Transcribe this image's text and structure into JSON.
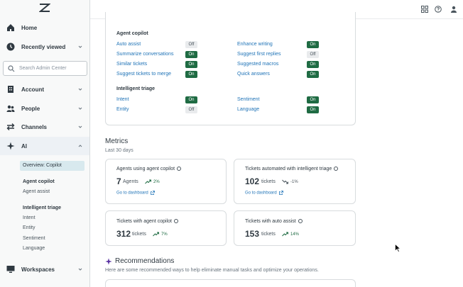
{
  "sidebar": {
    "nav": [
      {
        "label": "Home"
      },
      {
        "label": "Recently viewed"
      },
      {
        "label": "Account"
      },
      {
        "label": "People"
      },
      {
        "label": "Channels"
      },
      {
        "label": "AI"
      },
      {
        "label": "Workspaces"
      }
    ],
    "search_placeholder": "Search Admin Center",
    "ai_submenu": {
      "overview": "Overview: Copilot",
      "agent_copilot_header": "Agent copilot",
      "agent_assist": "Agent assist",
      "intelligent_triage_header": "Intelligent triage",
      "intent": "Intent",
      "entity": "Entity",
      "sentiment": "Sentiment",
      "language": "Language"
    }
  },
  "settings": {
    "agent_copilot": {
      "title": "Agent copilot",
      "left": [
        {
          "label": "Auto assist",
          "state": "Off"
        },
        {
          "label": "Summarize conversations",
          "state": "On"
        },
        {
          "label": "Similar tickets",
          "state": "On"
        },
        {
          "label": "Suggest tickets to merge",
          "state": "On"
        }
      ],
      "right": [
        {
          "label": "Enhance writing",
          "state": "On"
        },
        {
          "label": "Suggest first replies",
          "state": "Off"
        },
        {
          "label": "Suggested macros",
          "state": "On"
        },
        {
          "label": "Quick answers",
          "state": "On"
        }
      ]
    },
    "intelligent_triage": {
      "title": "Intelligent triage",
      "left": [
        {
          "label": "Intent",
          "state": "On"
        },
        {
          "label": "Entity",
          "state": "Off"
        }
      ],
      "right": [
        {
          "label": "Sentiment",
          "state": "On"
        },
        {
          "label": "Language",
          "state": "On"
        }
      ]
    }
  },
  "metrics": {
    "title": "Metrics",
    "subtitle": "Last 30 days",
    "cards": [
      {
        "title": "Agents using agent copilot",
        "value": "7",
        "unit": "Agents",
        "delta": "2%",
        "direction": "up",
        "link": "Go to dashboard"
      },
      {
        "title": "Tickets automated with intelligent triage",
        "value": "102",
        "unit": "tickets",
        "delta": "-1%",
        "direction": "down",
        "link": "Go to dashboard"
      },
      {
        "title": "Tickets with agent copilot",
        "value": "312",
        "unit": "tickets",
        "delta": "7%",
        "direction": "up"
      },
      {
        "title": "Tickets with auto assist",
        "value": "153",
        "unit": "tickets",
        "delta": "14%",
        "direction": "up"
      }
    ]
  },
  "recommendations": {
    "title": "Recommendations",
    "subtitle": "Here are some recommended ways to help eliminate manual tasks and optimize your operations."
  },
  "colors": {
    "on_toggle": "#1f6b43",
    "off_toggle": "#e9ebed",
    "link": "#1f73b7",
    "positive": "#1f6b43",
    "negative": "#49545c",
    "active_pill": "#d8e9ee"
  },
  "icons": {
    "logo": "zendesk-logo",
    "header": [
      "grid-icon",
      "help-icon",
      "user-icon"
    ]
  }
}
